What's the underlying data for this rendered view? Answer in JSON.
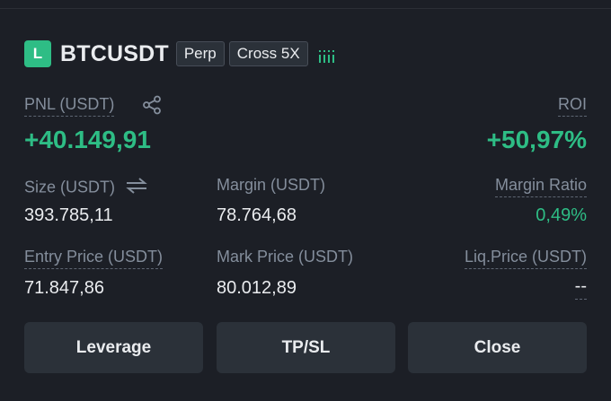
{
  "position": {
    "side_badge": "L",
    "symbol": "BTCUSDT",
    "type_tag": "Perp",
    "margin_tag": "Cross 5X",
    "side_color": "#2ebd85"
  },
  "pnl": {
    "label": "PNL (USDT)",
    "value": "+40.149,91",
    "share_icon": "share-icon"
  },
  "roi": {
    "label": "ROI",
    "value": "+50,97%"
  },
  "size": {
    "label": "Size (USDT)",
    "value": "393.785,11",
    "swap_icon": "swap-arrows-icon"
  },
  "margin": {
    "label": "Margin (USDT)",
    "value": "78.764,68"
  },
  "margin_ratio": {
    "label": "Margin Ratio",
    "value": "0,49%"
  },
  "entry_price": {
    "label": "Entry Price (USDT)",
    "value": "71.847,86"
  },
  "mark_price": {
    "label": "Mark Price (USDT)",
    "value": "80.012,89"
  },
  "liq_price": {
    "label": "Liq.Price (USDT)",
    "value": "--"
  },
  "buttons": {
    "leverage": "Leverage",
    "tpsl": "TP/SL",
    "close": "Close"
  }
}
